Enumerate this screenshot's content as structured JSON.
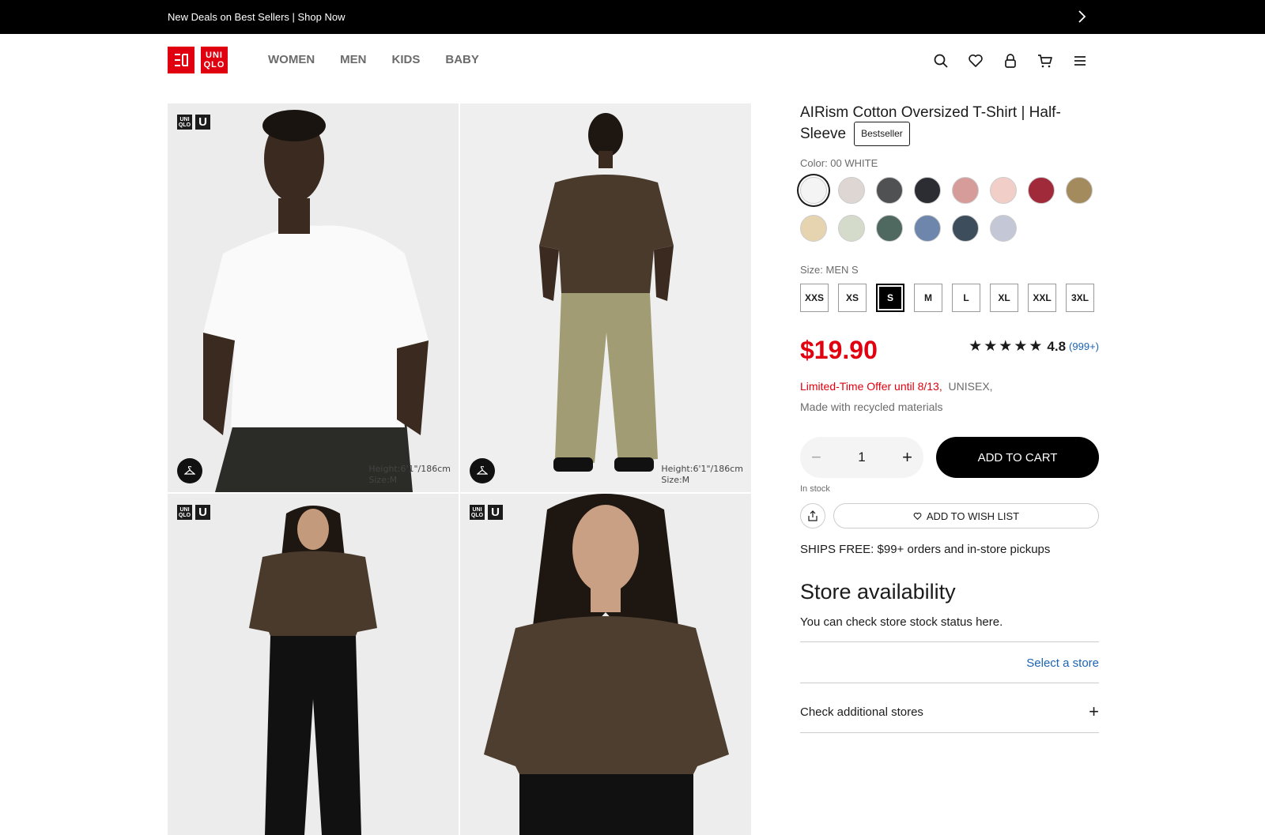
{
  "promo": {
    "text": "New Deals on Best Sellers | Shop Now",
    "arrow_icon": "chevron-right-icon"
  },
  "header": {
    "logo": {
      "top": "UNI",
      "bottom": "QLO"
    },
    "nav": [
      "WOMEN",
      "MEN",
      "KIDS",
      "BABY"
    ],
    "icons": [
      "search-icon",
      "heart-icon",
      "user-icon",
      "cart-icon",
      "menu-icon"
    ]
  },
  "gallery": {
    "badges": {
      "uniqlo_top": "UNI",
      "uniqlo_bottom": "QLO",
      "u": "U"
    },
    "photos": [
      {
        "model_height": "Height:6'1\"/186cm",
        "model_size": "Size:M"
      },
      {
        "model_height": "Height:6'1\"/186cm",
        "model_size": "Size:M"
      },
      {
        "model_height": "",
        "model_size": ""
      },
      {
        "model_height": "",
        "model_size": ""
      }
    ]
  },
  "product": {
    "title": "AIRism Cotton Oversized T-Shirt | Half-Sleeve",
    "badge": "Bestseller",
    "color_label": "Color: 00 WHITE",
    "colors": [
      "#f4f4f4",
      "#ddd6d2",
      "#4f5153",
      "#2b2d33",
      "#d69c9a",
      "#f1cec7",
      "#a0293a",
      "#a38b5e",
      "#e6d3b0",
      "#d5dbca",
      "#4f6860",
      "#6e86ac",
      "#3e4d5c",
      "#c4c8d6"
    ],
    "size_label": "Size: MEN S",
    "sizes": [
      "XXS",
      "XS",
      "S",
      "M",
      "L",
      "XL",
      "XXL",
      "3XL"
    ],
    "selected_size": "S",
    "price": "$19.90",
    "rating": "4.8",
    "rating_stars": 5,
    "review_count": "(999+)",
    "offer": "Limited-Time Offer until 8/13,",
    "gender": "UNISEX,",
    "materials": "Made with recycled materials",
    "quantity": "1",
    "add_to_cart": "ADD TO CART",
    "stock": "In stock",
    "wishlist": "ADD TO WISH LIST",
    "shipping": "SHIPS FREE: $99+ orders and in-store pickups"
  },
  "store": {
    "heading": "Store availability",
    "subtext": "You can check store stock status here.",
    "select_link": "Select a store",
    "additional": "Check additional stores"
  }
}
